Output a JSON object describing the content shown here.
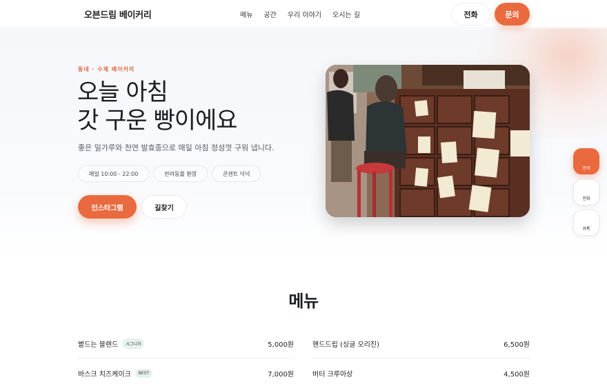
{
  "header": {
    "brand": "오븐드림 베이커리",
    "nav": [
      "메뉴",
      "공간",
      "우리 이야기",
      "오시는 길"
    ],
    "call_label": "전화",
    "ask_label": "문의"
  },
  "hero": {
    "eyebrow": "동네 · 수제 베이커리",
    "title_line1": "오늘 아침",
    "title_line2": "갓 구운 빵이에요",
    "subtitle": "좋은 밀가루와 천연 발효종으로 매일 아침 정성껏 구워 냅니다.",
    "chips": [
      "매일 10:00 - 22:00",
      "반려동물 환영",
      "콘센트 넉넉"
    ],
    "cta_primary": "인스타그램",
    "cta_secondary": "길찾기"
  },
  "floating": {
    "ask": "문의",
    "call": "전화",
    "talk": "카톡"
  },
  "menu": {
    "title": "메뉴",
    "items": [
      {
        "name": "볕드는 블렌드",
        "tag": "시그니처",
        "price": "5,000원"
      },
      {
        "name": "핸드드립 (싱글 오리진)",
        "tag": "",
        "price": "6,500원"
      },
      {
        "name": "바스크 치즈케이크",
        "tag": "BEST",
        "price": "7,000원"
      },
      {
        "name": "버터 크루아상",
        "tag": "",
        "price": "4,500원"
      }
    ]
  },
  "colors": {
    "accent": "#ea6a3f",
    "tag_bg": "#e6f2ea"
  }
}
